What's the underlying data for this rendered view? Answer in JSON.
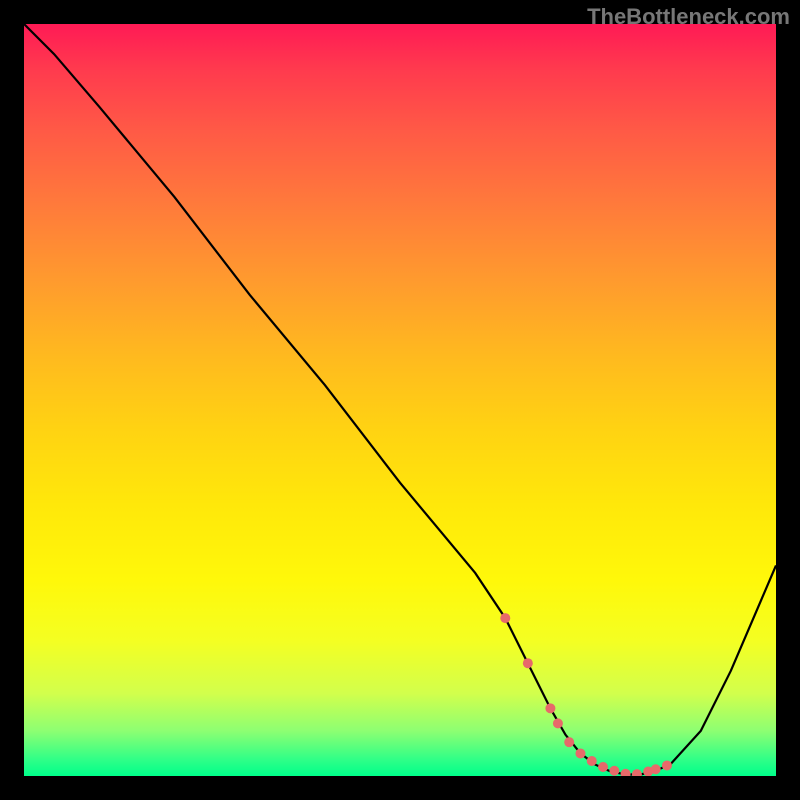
{
  "watermark": "TheBottleneck.com",
  "chart_data": {
    "type": "line",
    "title": "",
    "xlabel": "",
    "ylabel": "",
    "xlim": [
      0,
      100
    ],
    "ylim": [
      0,
      100
    ],
    "x": [
      0,
      4,
      10,
      20,
      30,
      40,
      50,
      60,
      64,
      67,
      70,
      72,
      74,
      76,
      78,
      80,
      82,
      84,
      86,
      90,
      94,
      100
    ],
    "values": [
      100,
      96,
      89,
      77,
      64,
      52,
      39,
      27,
      21,
      15,
      9,
      5.5,
      3,
      1.5,
      0.6,
      0.2,
      0.2,
      0.7,
      1.6,
      6,
      14,
      28
    ],
    "marker_points_x": [
      64,
      67,
      70,
      71,
      72.5,
      74,
      75.5,
      77,
      78.5,
      80,
      81.5,
      83,
      84,
      85.5
    ],
    "marker_points_y": [
      21,
      15,
      9,
      7,
      4.5,
      3,
      2,
      1.2,
      0.7,
      0.3,
      0.25,
      0.6,
      0.9,
      1.4
    ]
  },
  "colors": {
    "background": "#000000",
    "line": "#000000",
    "marker": "#e76a6a"
  }
}
